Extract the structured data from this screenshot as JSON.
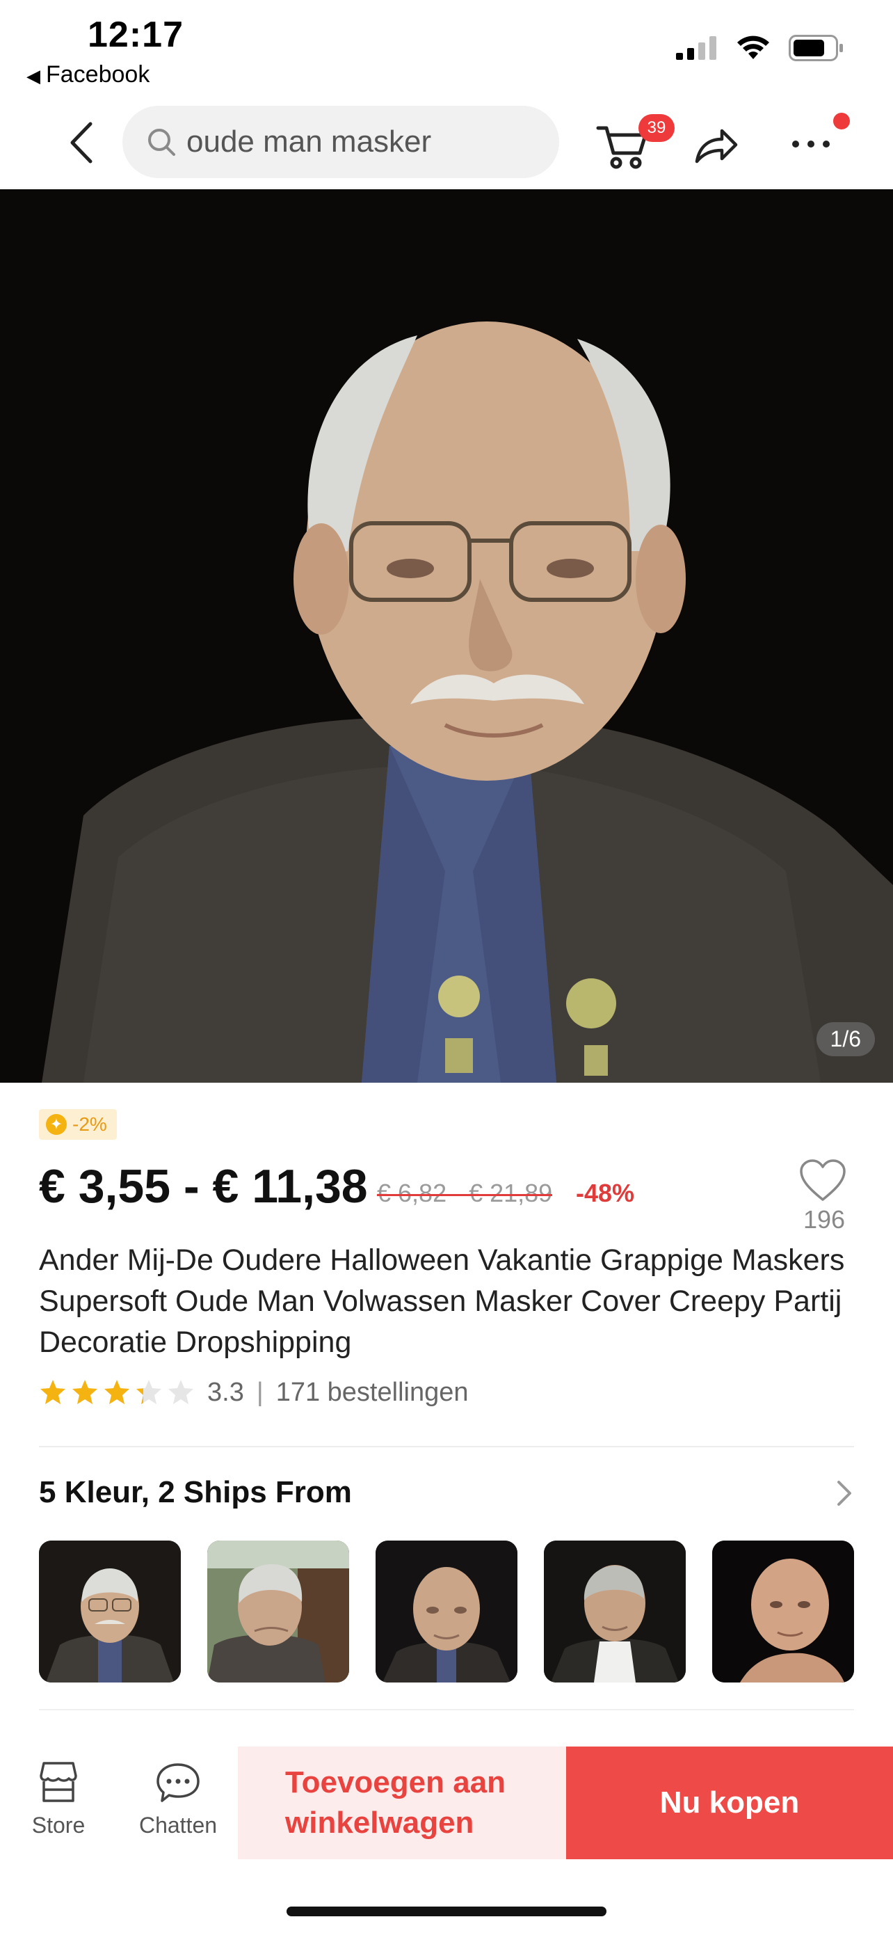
{
  "status_bar": {
    "time": "12:17",
    "back_app": "Facebook",
    "icons": [
      "signal-icon",
      "wifi-icon",
      "battery-icon"
    ]
  },
  "nav": {
    "search_value": "oude man masker",
    "cart_badge": "39",
    "icons": [
      "back-chevron-icon",
      "search-icon",
      "cart-icon",
      "share-icon",
      "more-icon"
    ]
  },
  "hero": {
    "counter": "1/6"
  },
  "product": {
    "coin_discount": "-2%",
    "price": "€ 3,55 - € 11,38",
    "original_price": "€ 6,82 - € 21,89",
    "discount": "-48%",
    "wishlist_count": "196",
    "title": "Ander Mij-De Oudere Halloween Vakantie Grappige Maskers Supersoft Oude Man Volwassen Masker Cover Creepy Partij Decoratie Dropshipping",
    "rating": "3.3",
    "rating_value": 3.3,
    "orders": "171 bestellingen"
  },
  "variants": {
    "heading": "5 Kleur, 2 Ships From",
    "thumbnails": [
      "old-man-glasses",
      "old-man-outdoor",
      "bald-old-man",
      "old-man-white-shirt",
      "bald-mask-side"
    ]
  },
  "bottom_bar": {
    "store_label": "Store",
    "chat_label": "Chatten",
    "add_to_cart": "Toevoegen aan winkelwagen",
    "buy_now": "Nu kopen"
  },
  "colors": {
    "accent": "#ee4a47",
    "accent_light": "#fdecec",
    "star": "#f5b312",
    "discount": "#e03b3b"
  }
}
